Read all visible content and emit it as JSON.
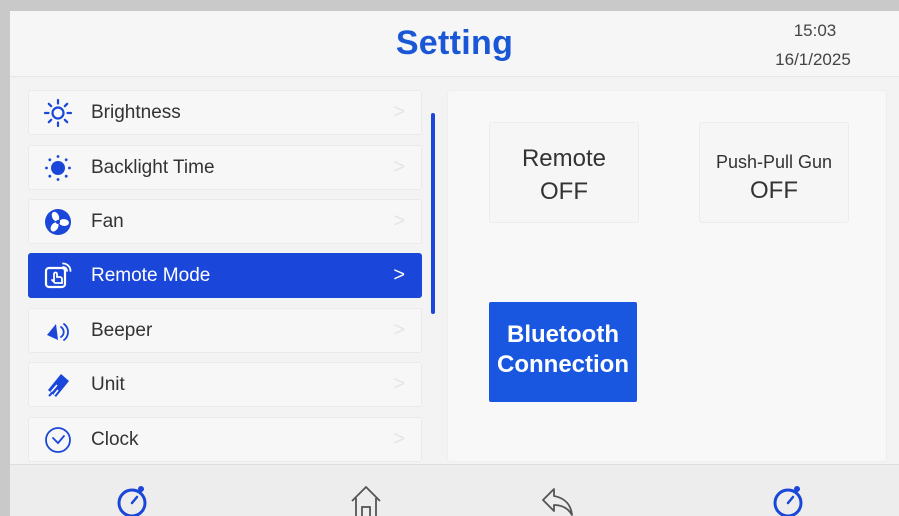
{
  "header": {
    "title": "Setting",
    "time": "15:03",
    "date": "16/1/2025"
  },
  "menu": {
    "items": [
      {
        "label": "Brightness",
        "icon": "sun-icon",
        "active": false
      },
      {
        "label": "Backlight Time",
        "icon": "backlight-icon",
        "active": false
      },
      {
        "label": "Fan",
        "icon": "fan-icon",
        "active": false
      },
      {
        "label": "Remote Mode",
        "icon": "remote-touch-icon",
        "active": true
      },
      {
        "label": "Beeper",
        "icon": "speaker-icon",
        "active": false
      },
      {
        "label": "Unit",
        "icon": "ruler-icon",
        "active": false
      },
      {
        "label": "Clock",
        "icon": "clock-icon",
        "active": false
      }
    ],
    "chevron": ">"
  },
  "panel": {
    "remote": {
      "title": "Remote",
      "state": "OFF"
    },
    "push_pull_gun": {
      "title": "Push-Pull Gun",
      "state": "OFF"
    },
    "bluetooth": {
      "line1": "Bluetooth",
      "line2": "Connection"
    }
  },
  "footer": {
    "icons": [
      "gauge-left-icon",
      "home-icon",
      "back-icon",
      "gauge-right-icon"
    ]
  },
  "colors": {
    "accent": "#1a47d9",
    "title": "#1a57d6",
    "background": "#f3f3f3"
  }
}
